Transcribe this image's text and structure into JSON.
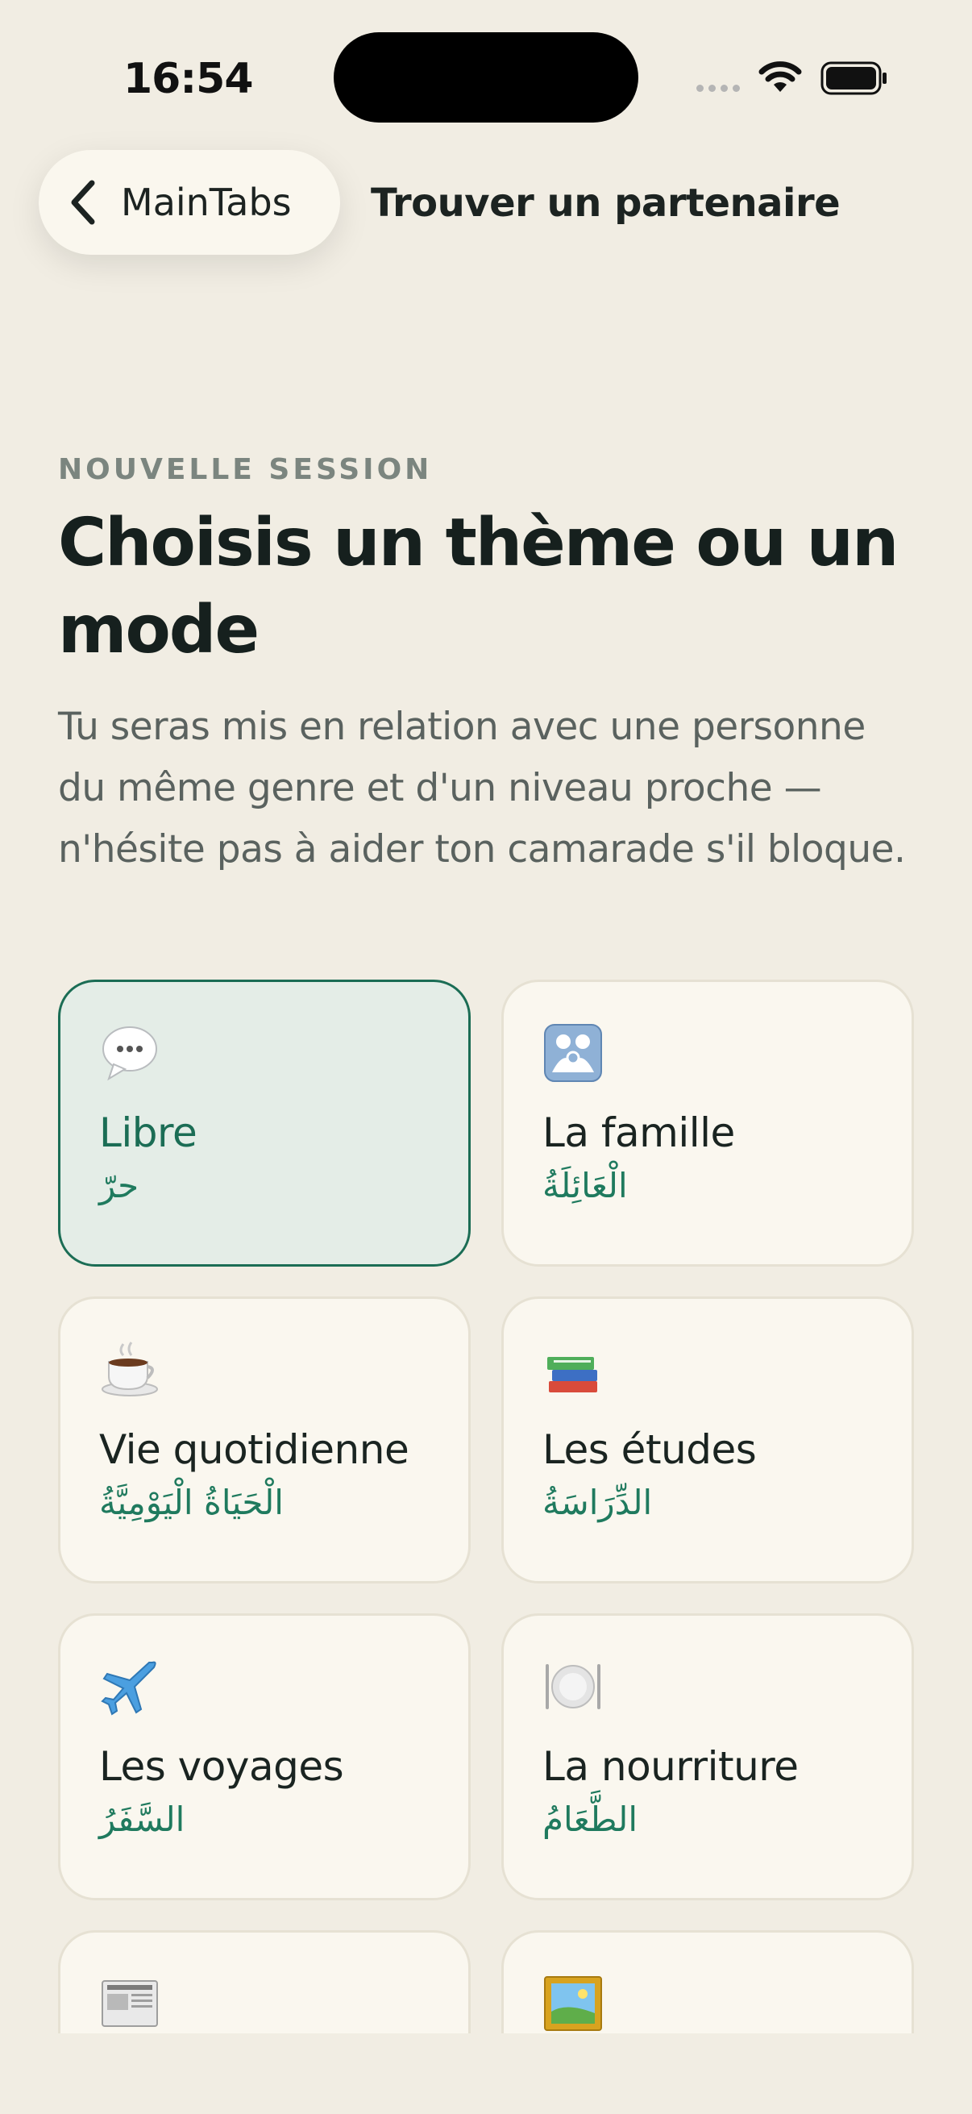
{
  "status_bar": {
    "time": "16:54"
  },
  "nav": {
    "back_label": "MainTabs",
    "title": "Trouver un partenaire"
  },
  "header": {
    "eyebrow": "NOUVELLE SESSION",
    "title": "Choisis un thème ou un mode",
    "subtitle": "Tu seras mis en relation avec une personne du même genre et d'un niveau proche — n'hésite pas à aider ton camarade s'il bloque."
  },
  "themes": [
    {
      "label": "Libre",
      "arabic": "حرّ",
      "icon": "speech-bubble-icon",
      "selected": true
    },
    {
      "label": "La famille",
      "arabic": "الْعَائِلَةُ",
      "icon": "family-icon",
      "selected": false
    },
    {
      "label": "Vie quotidienne",
      "arabic": "الْحَيَاةُ الْيَوْمِيَّةُ",
      "icon": "coffee-icon",
      "selected": false
    },
    {
      "label": "Les études",
      "arabic": "الدِّرَاسَةُ",
      "icon": "books-icon",
      "selected": false
    },
    {
      "label": "Les voyages",
      "arabic": "السَّفَرُ",
      "icon": "airplane-icon",
      "selected": false
    },
    {
      "label": "La nourriture",
      "arabic": "الطَّعَامُ",
      "icon": "plate-icon",
      "selected": false
    },
    {
      "label": "",
      "arabic": "",
      "icon": "newspaper-icon",
      "selected": false
    },
    {
      "label": "",
      "arabic": "",
      "icon": "framed-picture-icon",
      "selected": false
    }
  ],
  "colors": {
    "background": "#f1ede3",
    "card": "#faf7ef",
    "accent": "#1b6d55",
    "selected_card": "#e4ede7"
  }
}
